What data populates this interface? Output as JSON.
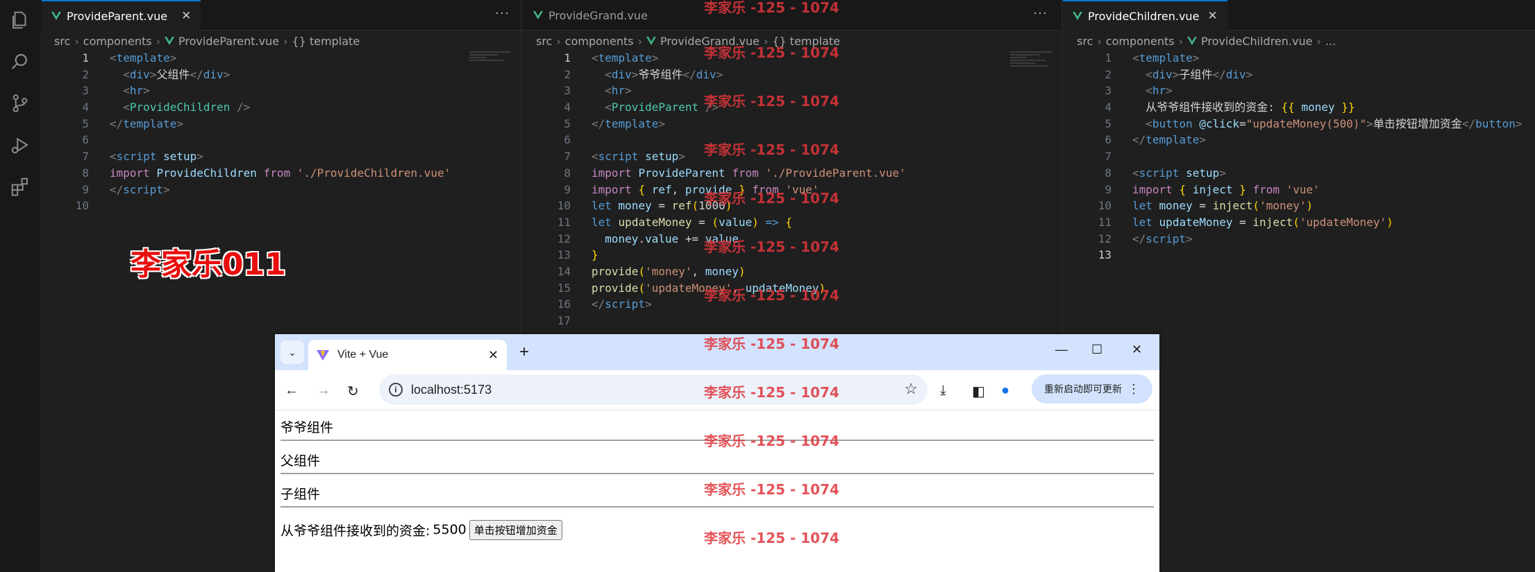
{
  "watermark": {
    "small": "李家乐 -125 - 1074",
    "big": "李家乐011"
  },
  "activity_icons": [
    "files-icon",
    "search-icon",
    "source-control-icon",
    "run-debug-icon",
    "extensions-icon"
  ],
  "panes": [
    {
      "tab": "ProvideParent.vue",
      "breadcrumb": [
        "src",
        "components",
        "ProvideParent.vue",
        "{} template"
      ],
      "current_line": 1,
      "lines": [
        [
          [
            "tg",
            "<"
          ],
          [
            "tn",
            "template"
          ],
          [
            "tg",
            ">"
          ]
        ],
        [
          [
            "pl",
            "  "
          ],
          [
            "tg",
            "<"
          ],
          [
            "tn",
            "div"
          ],
          [
            "tg",
            ">"
          ],
          [
            "pl",
            "父组件"
          ],
          [
            "tg",
            "</"
          ],
          [
            "tn",
            "div"
          ],
          [
            "tg",
            ">"
          ]
        ],
        [
          [
            "pl",
            "  "
          ],
          [
            "tg",
            "<"
          ],
          [
            "tn",
            "hr"
          ],
          [
            "tg",
            ">"
          ]
        ],
        [
          [
            "pl",
            "  "
          ],
          [
            "tg",
            "<"
          ],
          [
            "cmp",
            "ProvideChildren"
          ],
          [
            "pl",
            " "
          ],
          [
            "tg",
            "/>"
          ]
        ],
        [
          [
            "tg",
            "</"
          ],
          [
            "tn",
            "template"
          ],
          [
            "tg",
            ">"
          ]
        ],
        [],
        [
          [
            "tg",
            "<"
          ],
          [
            "tn",
            "script"
          ],
          [
            "pl",
            " "
          ],
          [
            "at",
            "setup"
          ],
          [
            "tg",
            ">"
          ]
        ],
        [
          [
            "kw",
            "import"
          ],
          [
            "pl",
            " "
          ],
          [
            "vr",
            "ProvideChildren"
          ],
          [
            "pl",
            " "
          ],
          [
            "kw",
            "from"
          ],
          [
            "pl",
            " "
          ],
          [
            "str",
            "'./ProvideChildren.vue'"
          ]
        ],
        [
          [
            "tg",
            "</"
          ],
          [
            "tn",
            "script"
          ],
          [
            "tg",
            ">"
          ]
        ],
        []
      ]
    },
    {
      "tab": "ProvideGrand.vue",
      "breadcrumb": [
        "src",
        "components",
        "ProvideGrand.vue",
        "{} template"
      ],
      "current_line": 1,
      "lines": [
        [
          [
            "tg",
            "<"
          ],
          [
            "tn",
            "template"
          ],
          [
            "tg",
            ">"
          ]
        ],
        [
          [
            "pl",
            "  "
          ],
          [
            "tg",
            "<"
          ],
          [
            "tn",
            "div"
          ],
          [
            "tg",
            ">"
          ],
          [
            "pl",
            "爷爷组件"
          ],
          [
            "tg",
            "</"
          ],
          [
            "tn",
            "div"
          ],
          [
            "tg",
            ">"
          ]
        ],
        [
          [
            "pl",
            "  "
          ],
          [
            "tg",
            "<"
          ],
          [
            "tn",
            "hr"
          ],
          [
            "tg",
            ">"
          ]
        ],
        [
          [
            "pl",
            "  "
          ],
          [
            "tg",
            "<"
          ],
          [
            "cmp",
            "ProvideParent"
          ],
          [
            "pl",
            " "
          ],
          [
            "tg",
            "/>"
          ]
        ],
        [
          [
            "tg",
            "</"
          ],
          [
            "tn",
            "template"
          ],
          [
            "tg",
            ">"
          ]
        ],
        [],
        [
          [
            "tg",
            "<"
          ],
          [
            "tn",
            "script"
          ],
          [
            "pl",
            " "
          ],
          [
            "at",
            "setup"
          ],
          [
            "tg",
            ">"
          ]
        ],
        [
          [
            "kw",
            "import"
          ],
          [
            "pl",
            " "
          ],
          [
            "vr",
            "ProvideParent"
          ],
          [
            "pl",
            " "
          ],
          [
            "kw",
            "from"
          ],
          [
            "pl",
            " "
          ],
          [
            "str",
            "'./ProvideParent.vue'"
          ]
        ],
        [
          [
            "kw",
            "import"
          ],
          [
            "pl",
            " "
          ],
          [
            "br",
            "{"
          ],
          [
            "pl",
            " "
          ],
          [
            "vr",
            "ref"
          ],
          [
            "pl",
            ", "
          ],
          [
            "vr",
            "provide"
          ],
          [
            "pl",
            " "
          ],
          [
            "br",
            "}"
          ],
          [
            "pl",
            " "
          ],
          [
            "kw",
            "from"
          ],
          [
            "pl",
            " "
          ],
          [
            "str",
            "'vue'"
          ]
        ],
        [
          [
            "tn",
            "let"
          ],
          [
            "pl",
            " "
          ],
          [
            "vr",
            "money"
          ],
          [
            "op",
            " = "
          ],
          [
            "fn",
            "ref"
          ],
          [
            "br",
            "("
          ],
          [
            "pl",
            "1000"
          ],
          [
            "br",
            ")"
          ]
        ],
        [
          [
            "tn",
            "let"
          ],
          [
            "pl",
            " "
          ],
          [
            "fn",
            "updateMoney"
          ],
          [
            "op",
            " = "
          ],
          [
            "br",
            "("
          ],
          [
            "vr",
            "value"
          ],
          [
            "br",
            ")"
          ],
          [
            "pl",
            " "
          ],
          [
            "tn",
            "=>"
          ],
          [
            "pl",
            " "
          ],
          [
            "br",
            "{"
          ]
        ],
        [
          [
            "pl",
            "  "
          ],
          [
            "vr",
            "money"
          ],
          [
            "pl",
            "."
          ],
          [
            "vr",
            "value"
          ],
          [
            "op",
            " += "
          ],
          [
            "vr",
            "value"
          ]
        ],
        [
          [
            "br",
            "}"
          ]
        ],
        [
          [
            "fn",
            "provide"
          ],
          [
            "br",
            "("
          ],
          [
            "str",
            "'money'"
          ],
          [
            "pl",
            ", "
          ],
          [
            "vr",
            "money"
          ],
          [
            "br",
            ")"
          ]
        ],
        [
          [
            "fn",
            "provide"
          ],
          [
            "br",
            "("
          ],
          [
            "str",
            "'updateMoney'"
          ],
          [
            "pl",
            ", "
          ],
          [
            "vr",
            "updateMoney"
          ],
          [
            "br",
            ")"
          ]
        ],
        [
          [
            "tg",
            "</"
          ],
          [
            "tn",
            "script"
          ],
          [
            "tg",
            ">"
          ]
        ],
        []
      ]
    },
    {
      "tab": "ProvideChildren.vue",
      "breadcrumb": [
        "src",
        "components",
        "ProvideChildren.vue",
        "..."
      ],
      "current_line": 13,
      "lines": [
        [
          [
            "tg",
            "<"
          ],
          [
            "tn",
            "template"
          ],
          [
            "tg",
            ">"
          ]
        ],
        [
          [
            "pl",
            "  "
          ],
          [
            "tg",
            "<"
          ],
          [
            "tn",
            "div"
          ],
          [
            "tg",
            ">"
          ],
          [
            "pl",
            "子组件"
          ],
          [
            "tg",
            "</"
          ],
          [
            "tn",
            "div"
          ],
          [
            "tg",
            ">"
          ]
        ],
        [
          [
            "pl",
            "  "
          ],
          [
            "tg",
            "<"
          ],
          [
            "tn",
            "hr"
          ],
          [
            "tg",
            ">"
          ]
        ],
        [
          [
            "pl",
            "  从爷爷组件接收到的资金: "
          ],
          [
            "br",
            "{{"
          ],
          [
            "pl",
            " "
          ],
          [
            "vr",
            "money"
          ],
          [
            "pl",
            " "
          ],
          [
            "br",
            "}}"
          ]
        ],
        [
          [
            "pl",
            "  "
          ],
          [
            "tg",
            "<"
          ],
          [
            "tn",
            "button"
          ],
          [
            "pl",
            " "
          ],
          [
            "at",
            "@click"
          ],
          [
            "pl",
            "="
          ],
          [
            "str",
            "\"updateMoney(500)\""
          ],
          [
            "tg",
            ">"
          ],
          [
            "pl",
            "单击按钮增加资金"
          ],
          [
            "tg",
            "</"
          ],
          [
            "tn",
            "button"
          ],
          [
            "tg",
            ">"
          ]
        ],
        [
          [
            "tg",
            "</"
          ],
          [
            "tn",
            "template"
          ],
          [
            "tg",
            ">"
          ]
        ],
        [],
        [
          [
            "tg",
            "<"
          ],
          [
            "tn",
            "script"
          ],
          [
            "pl",
            " "
          ],
          [
            "at",
            "setup"
          ],
          [
            "tg",
            ">"
          ]
        ],
        [
          [
            "kw",
            "import"
          ],
          [
            "pl",
            " "
          ],
          [
            "br",
            "{"
          ],
          [
            "pl",
            " "
          ],
          [
            "vr",
            "inject"
          ],
          [
            "pl",
            " "
          ],
          [
            "br",
            "}"
          ],
          [
            "pl",
            " "
          ],
          [
            "kw",
            "from"
          ],
          [
            "pl",
            " "
          ],
          [
            "str",
            "'vue'"
          ]
        ],
        [
          [
            "tn",
            "let"
          ],
          [
            "pl",
            " "
          ],
          [
            "vr",
            "money"
          ],
          [
            "op",
            " = "
          ],
          [
            "fn",
            "inject"
          ],
          [
            "br",
            "("
          ],
          [
            "str",
            "'money'"
          ],
          [
            "br",
            ")"
          ]
        ],
        [
          [
            "tn",
            "let"
          ],
          [
            "pl",
            " "
          ],
          [
            "vr",
            "updateMoney"
          ],
          [
            "op",
            " = "
          ],
          [
            "fn",
            "inject"
          ],
          [
            "br",
            "("
          ],
          [
            "str",
            "'updateMoney'"
          ],
          [
            "br",
            ")"
          ]
        ],
        [
          [
            "tg",
            "</"
          ],
          [
            "tn",
            "script"
          ],
          [
            "tg",
            ">"
          ]
        ],
        []
      ]
    }
  ],
  "browser": {
    "tab_title": "Vite + Vue",
    "url": "localhost:5173",
    "update_button": "重新启动即可更新",
    "content": {
      "grand": "爷爷组件",
      "parent": "父组件",
      "child": "子组件",
      "money_label": "从爷爷组件接收到的资金:",
      "money_value": "5500",
      "button": "单击按钮增加资金"
    }
  }
}
